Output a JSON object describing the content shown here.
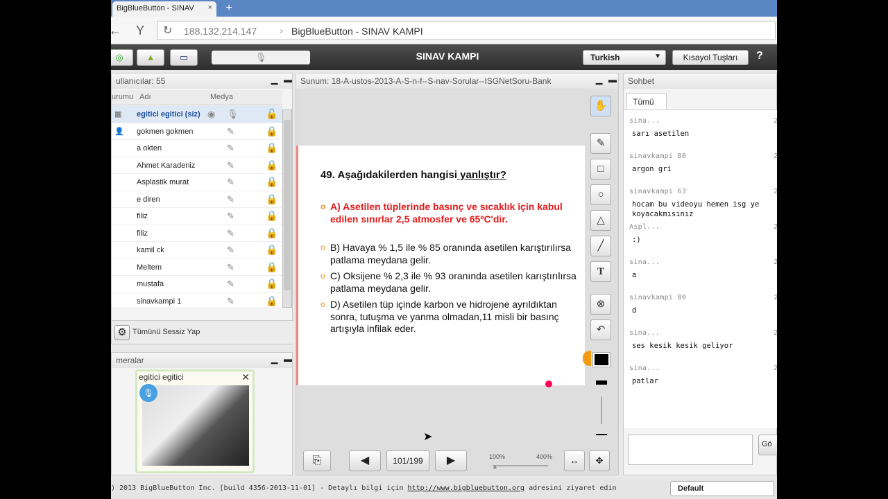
{
  "browser": {
    "tab_title": "BigBlueButton - SINAV",
    "tab_close": "×",
    "new_tab": "+",
    "back": "←",
    "yandex": "Y",
    "reload": "↻",
    "url": "188.132.214.147",
    "url_sep": "›",
    "page_title": "BigBlueButton - SINAV KAMPI"
  },
  "toolbar": {
    "conference_title": "SINAV KAMPI",
    "language": "Turkish",
    "shortcuts": "Kısayol Tuşları",
    "help": "?",
    "mic": "🎙"
  },
  "users": {
    "title": "ullanıcılar: 55",
    "col_status": "urumu",
    "col_name": "Adı",
    "col_media": "Medya",
    "mute_all": "Tümünü Sessiz Yap",
    "rows": [
      {
        "name": "egitici egitici (siz)"
      },
      {
        "name": "gokmen gokmen"
      },
      {
        "name": "a okten"
      },
      {
        "name": "Ahmet Karadeniz"
      },
      {
        "name": "Asplastik murat"
      },
      {
        "name": "e diren"
      },
      {
        "name": "filiz"
      },
      {
        "name": "filiz"
      },
      {
        "name": "kamil ck"
      },
      {
        "name": "Meltem"
      },
      {
        "name": "mustafa"
      },
      {
        "name": "sinavkampi 1"
      }
    ]
  },
  "cameras": {
    "title": "meralar",
    "cam_user": "egitici egitici",
    "close": "✕"
  },
  "presentation": {
    "title": "Sunum: 18-A-ustos-2013-A-S-n-f--S-nav-Sorular--ISGNetSoru-Bank",
    "page": "101/199",
    "zoom_min": "100%",
    "zoom_max": "400%",
    "question_prefix": "49. Aşağıdakilerden hangisi",
    "question_underlined": " yanlıştır?",
    "options": [
      "A) Asetilen tüplerinde basınç ve sıcaklık için kabul edilen sınırlar 2,5 atmosfer ve 65ºC'dir.",
      "B) Havaya % 1,5 ile % 85 oranında asetilen karıştırılırsa patlama meydana gelir.",
      "C) Oksijene % 2,3 ile % 93 oranında asetilen karıştırılırsa patlama meydana gelir.",
      "D) Asetilen tüp içinde karbon ve hidrojene ayrıldıktan sonra, tutuşma ve yanma olmadan,11 misli bir basınç artışıyla infilak eder."
    ],
    "bullet": "o"
  },
  "chat": {
    "title": "Sohbet",
    "tab": "Tümü",
    "send": "Gö",
    "messages": [
      {
        "who": "sina...",
        "ts": "2",
        "text": "sarı asetilen"
      },
      {
        "who": "sinavkampi 80",
        "ts": "2",
        "text": "argon gri"
      },
      {
        "who": "sinavkampi 63",
        "ts": "2",
        "text": "hocam bu videoyu hemen isg ye koyacakmısınız"
      },
      {
        "who": "Aspl...",
        "ts": "2",
        "text": ":)"
      },
      {
        "who": "sina...",
        "ts": "2",
        "text": "a"
      },
      {
        "who": "sinavkampi 80",
        "ts": "2",
        "text": "d"
      },
      {
        "who": "sina...",
        "ts": "2",
        "text": "ses kesik kesik geliyor"
      },
      {
        "who": "sina...",
        "ts": "2",
        "text": "patlar"
      }
    ]
  },
  "footer": {
    "text_pre": ") 2013 BigBlueButton Inc. [build 4356-2013-11-01] - Detaylı bilgi için ",
    "link": "http://www.bigbluebutton.org",
    "text_post": " adresini ziyaret edin",
    "layout": "Default"
  },
  "colors": {
    "accent": "#1a4d99",
    "answer_red": "#e21b1b",
    "bullet": "#e8962a"
  }
}
